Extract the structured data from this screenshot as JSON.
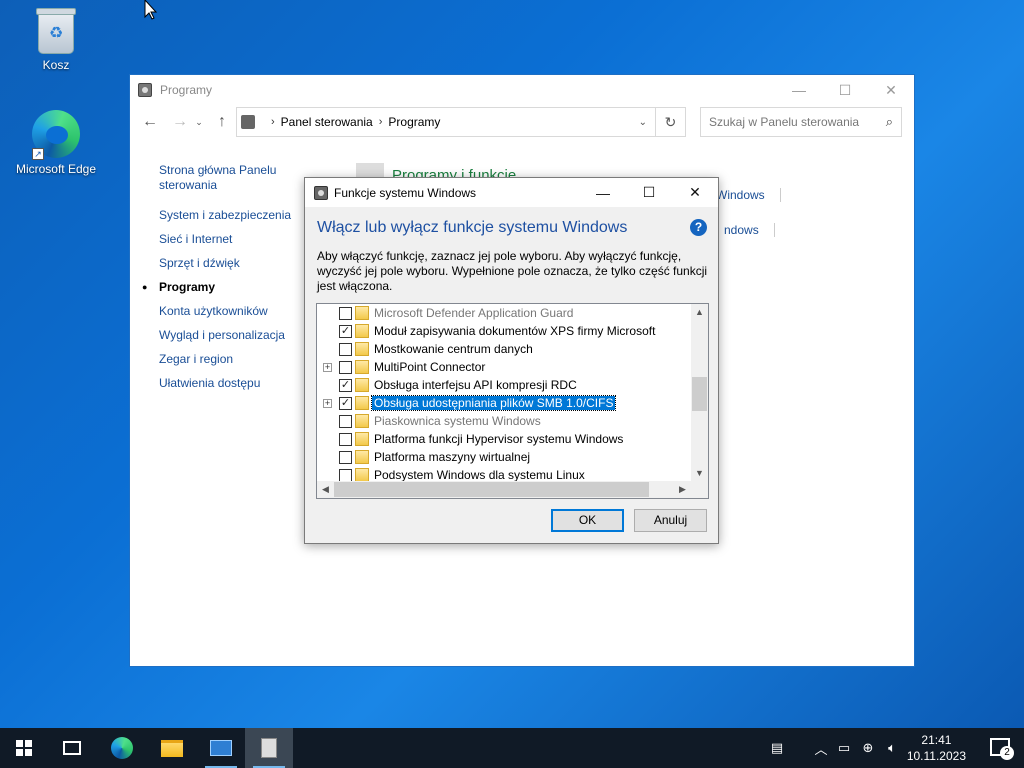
{
  "desktop": {
    "icons": [
      {
        "label": "Kosz",
        "icon": "recycle-bin-icon"
      },
      {
        "label": "Microsoft Edge",
        "icon": "edge-icon"
      }
    ]
  },
  "control_panel": {
    "title": "Programy",
    "breadcrumb": [
      "Panel sterowania",
      "Programy"
    ],
    "search_placeholder": "Szukaj w Panelu sterowania",
    "sidebar": {
      "home": "Strona główna Panelu sterowania",
      "items": [
        "System i zabezpieczenia",
        "Sieć i Internet",
        "Sprzęt i dźwięk",
        "Programy",
        "Konta użytkowników",
        "Wygląd i personalizacja",
        "Zegar i region",
        "Ułatwienia dostępu"
      ],
      "current_index": 3
    },
    "main": {
      "heading": "Programy i funkcje",
      "link_1": "Windows",
      "link_2": "ndows"
    }
  },
  "dialog": {
    "title": "Funkcje systemu Windows",
    "heading": "Włącz lub wyłącz funkcje systemu Windows",
    "help": "?",
    "description": "Aby włączyć funkcję, zaznacz jej pole wyboru. Aby wyłączyć funkcję, wyczyść jej pole wyboru. Wypełnione pole oznacza, że tylko część funkcji jest włączona.",
    "features": [
      {
        "label": "Microsoft Defender Application Guard",
        "checked": false,
        "expandable": false,
        "dim": true,
        "selected": false
      },
      {
        "label": "Moduł zapisywania dokumentów XPS firmy Microsoft",
        "checked": true,
        "expandable": false,
        "dim": false,
        "selected": false
      },
      {
        "label": "Mostkowanie centrum danych",
        "checked": false,
        "expandable": false,
        "dim": false,
        "selected": false
      },
      {
        "label": "MultiPoint Connector",
        "checked": false,
        "expandable": true,
        "dim": false,
        "selected": false
      },
      {
        "label": "Obsługa interfejsu API kompresji RDC",
        "checked": true,
        "expandable": false,
        "dim": false,
        "selected": false
      },
      {
        "label": "Obsługa udostępniania plików SMB 1.0/CIFS",
        "checked": true,
        "expandable": true,
        "dim": false,
        "selected": true
      },
      {
        "label": "Piaskownica systemu Windows",
        "checked": false,
        "expandable": false,
        "dim": true,
        "selected": false
      },
      {
        "label": "Platforma funkcji Hypervisor systemu Windows",
        "checked": false,
        "expandable": false,
        "dim": false,
        "selected": false
      },
      {
        "label": "Platforma maszyny wirtualnej",
        "checked": false,
        "expandable": false,
        "dim": false,
        "selected": false
      },
      {
        "label": "Podsystem Windows dla systemu Linux",
        "checked": false,
        "expandable": false,
        "dim": false,
        "selected": false
      }
    ],
    "ok_label": "OK",
    "cancel_label": "Anuluj"
  },
  "taskbar": {
    "time": "21:41",
    "date": "10.11.2023",
    "notification_count": "2"
  }
}
